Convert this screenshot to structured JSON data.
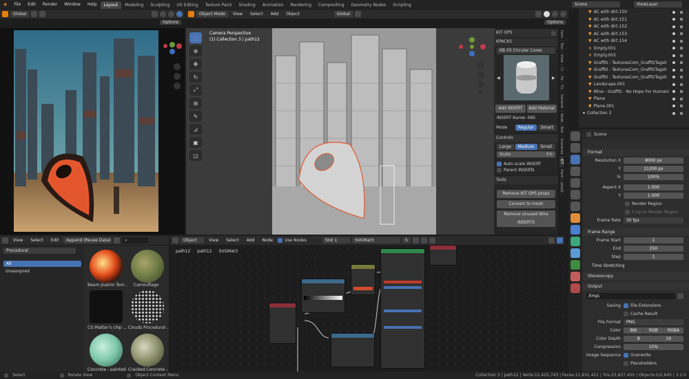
{
  "topbar": {
    "menus": [
      "File",
      "Edit",
      "Render",
      "Window",
      "Help"
    ],
    "workspaces": [
      "Layout",
      "Modeling",
      "Sculpting",
      "UV Editing",
      "Texture Paint",
      "Shading",
      "Animation",
      "Rendering",
      "Compositing",
      "Geometry Nodes",
      "Scripting"
    ],
    "scene": "Scene",
    "view_layer": "ViewLayer"
  },
  "left_viewport": {
    "transform": "Global",
    "options": "Options"
  },
  "main_viewport": {
    "mode": "Object Mode",
    "menus": [
      "View",
      "Select",
      "Add",
      "Object"
    ],
    "transform": "Global",
    "options": "Options",
    "camera": "Camera Perspective",
    "collection": "(1) Collection 3 | path12"
  },
  "kitops": {
    "title": "KIT OPS",
    "kpacks": "KPACKS",
    "kit_name": "KB 03 Circular Cores",
    "add_insert": "Add INSERT",
    "add_material": "Add Material",
    "insert_name": "INSERT Name: 085",
    "mode_label": "Mode",
    "mode_regular": "Regular",
    "mode_smart": "Smart",
    "controls": "Controls",
    "large": "Large",
    "medium": "Medium",
    "small": "Small",
    "scale_label": "Scale",
    "scale_value": "1%",
    "auto_scale": "Auto scale INSERT",
    "parent_inserts": "Parent INSERTs",
    "tools": "Tools",
    "remove_props": "Remove KIT OPS props",
    "convert_mesh": "Convert to mesh",
    "remove_unused": "Remove Unused Wire INSERTS"
  },
  "side_tabs": [
    "Item",
    "Tool",
    "View",
    "Cr",
    "Pa",
    "Tis",
    "Generat",
    "Relat",
    "Bak",
    "Scenerea",
    "KIT",
    "Hard",
    "polyQ"
  ],
  "outliner": {
    "items": [
      "AC with dirt.150",
      "AC with dirt.151",
      "AC with dirt.152",
      "AC with dirt.153",
      "AC with dirt.154",
      "Empty.001",
      "Empty.002",
      "Graffiti - TexturesCom_GraffitiTags0",
      "Graffiti - TexturesCom_GraffitiTags0",
      "Graffiti - TexturesCom_GraffitiTags0",
      "Landscape.001",
      "Mine - Graffiti - No Hope For Humani",
      "Plane",
      "Plane.001",
      "Collection 3"
    ]
  },
  "properties": {
    "scene": "Scene",
    "format": "Format",
    "resolution_x_label": "Resolution X",
    "resolution_x": "8000 px",
    "y_label": "Y",
    "resolution_y": "11200 px",
    "pct_label": "%",
    "resolution_pct": "100%",
    "aspect_x_label": "Aspect X",
    "aspect_x": "1.000",
    "aspect_y": "1.000",
    "render_region": "Render Region",
    "crop_region": "Crop to Render Region",
    "frame_rate_label": "Frame Rate",
    "frame_rate": "30 fps",
    "frame_range": "Frame Range",
    "frame_start_label": "Frame Start",
    "frame_start": "1",
    "end_label": "End",
    "frame_end": "250",
    "step_label": "Step",
    "frame_step": "1",
    "time_stretching": "Time Stretching",
    "stereoscopy": "Stereoscopy",
    "output": "Output",
    "output_path": "/tmp\\",
    "saving_label": "Saving",
    "file_extensions": "File Extensions",
    "cache_result": "Cache Result",
    "file_format_label": "File Format",
    "file_format": "PNG",
    "color_label": "Color",
    "bw": "BW",
    "rgb": "RGB",
    "rgba": "RGBA",
    "color_depth_label": "Color Depth",
    "depth_8": "8",
    "depth_16": "16",
    "compression_label": "Compression",
    "compression": "15%",
    "image_sequence_label": "Image Sequence",
    "overwrite": "Overwrite",
    "placeholders": "Placeholders"
  },
  "asset_browser": {
    "menus": [
      "View",
      "Select",
      "Edit"
    ],
    "import_mode": "Append (Reuse Data)",
    "library": "Procedural",
    "catalog_selected": "All",
    "catalog_unassigned": "Unassigned",
    "assets": [
      "Beam Joakim Tom...",
      "Camouflage",
      "CG Matter's chip ...",
      "Clouds Procedural ...",
      "Concrete - painted ...",
      "Cracked Concrete - ..."
    ]
  },
  "node_editor": {
    "object": "Object",
    "menus": [
      "View",
      "Select",
      "Add",
      "Node"
    ],
    "use_nodes": "Use Nodes",
    "slot": "Slot 1",
    "material": "SVGMat3",
    "users": "5",
    "breadcrumbs": [
      "path12",
      "path12",
      "SVGMat3"
    ],
    "nodes": [
      "Principled BSDF",
      "Material Output",
      "Color Ramp",
      "Mix",
      "Ambient Occlusion",
      "Bump",
      "Hue/Sat"
    ]
  },
  "statusbar": {
    "select": "Select",
    "rotate": "Rotate View",
    "context": "Object Context Menu",
    "stats": "Collection 3 | path12 | Verts:12,425,743 | Faces:11,931,421 | Tris:23,937,455 | Objects:0/2,645 | 3.2.0"
  }
}
